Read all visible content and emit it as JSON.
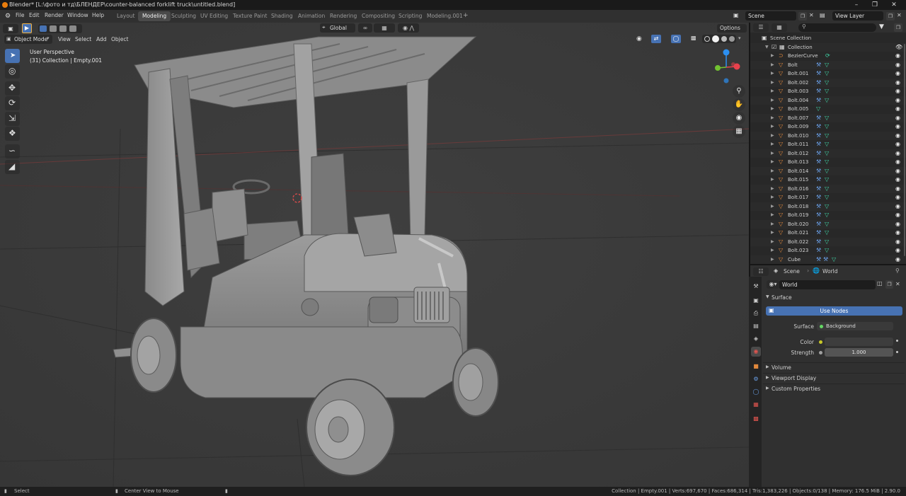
{
  "window": {
    "title": "Blender* [L:\\фото и тд\\БЛЕНДЕР\\counter-balanced forklift truck\\untitled.blend]"
  },
  "menus": [
    "File",
    "Edit",
    "Render",
    "Window",
    "Help"
  ],
  "workspaces": [
    {
      "label": "Layout",
      "active": false
    },
    {
      "label": "Modeling",
      "active": true
    },
    {
      "label": "Sculpting",
      "active": false
    },
    {
      "label": "UV Editing",
      "active": false
    },
    {
      "label": "Texture Paint",
      "active": false
    },
    {
      "label": "Shading",
      "active": false
    },
    {
      "label": "Animation",
      "active": false
    },
    {
      "label": "Rendering",
      "active": false
    },
    {
      "label": "Compositing",
      "active": false
    },
    {
      "label": "Scripting",
      "active": false
    },
    {
      "label": "Modeling.001",
      "active": false
    }
  ],
  "scene_selector": {
    "value": "Scene"
  },
  "view_layer_selector": {
    "value": "View Layer"
  },
  "viewport": {
    "mode": "Object Mode",
    "menus": [
      "View",
      "Select",
      "Add",
      "Object"
    ],
    "transform_orientation": "Global",
    "options_label": "Options",
    "overlay_line1": "User Perspective",
    "overlay_line2": "(31) Collection | Empty.001",
    "gizmo_axes": {
      "x": "X",
      "y": "Y",
      "z": "Z"
    }
  },
  "outliner": {
    "search_placeholder": "",
    "root": "Scene Collection",
    "collection": "Collection",
    "items": [
      {
        "name": "BezierCurve",
        "type": "curve",
        "mods": 0
      },
      {
        "name": "Bolt",
        "type": "mesh",
        "mods": 1
      },
      {
        "name": "Bolt.001",
        "type": "mesh",
        "mods": 1
      },
      {
        "name": "Bolt.002",
        "type": "mesh",
        "mods": 1
      },
      {
        "name": "Bolt.003",
        "type": "mesh",
        "mods": 1
      },
      {
        "name": "Bolt.004",
        "type": "mesh",
        "mods": 1
      },
      {
        "name": "Bolt.005",
        "type": "mesh",
        "mods": 0
      },
      {
        "name": "Bolt.007",
        "type": "mesh",
        "mods": 1
      },
      {
        "name": "Bolt.009",
        "type": "mesh",
        "mods": 1
      },
      {
        "name": "Bolt.010",
        "type": "mesh",
        "mods": 1
      },
      {
        "name": "Bolt.011",
        "type": "mesh",
        "mods": 1
      },
      {
        "name": "Bolt.012",
        "type": "mesh",
        "mods": 1
      },
      {
        "name": "Bolt.013",
        "type": "mesh",
        "mods": 1
      },
      {
        "name": "Bolt.014",
        "type": "mesh",
        "mods": 1
      },
      {
        "name": "Bolt.015",
        "type": "mesh",
        "mods": 1
      },
      {
        "name": "Bolt.016",
        "type": "mesh",
        "mods": 1
      },
      {
        "name": "Bolt.017",
        "type": "mesh",
        "mods": 1
      },
      {
        "name": "Bolt.018",
        "type": "mesh",
        "mods": 1
      },
      {
        "name": "Bolt.019",
        "type": "mesh",
        "mods": 1
      },
      {
        "name": "Bolt.020",
        "type": "mesh",
        "mods": 1
      },
      {
        "name": "Bolt.021",
        "type": "mesh",
        "mods": 1
      },
      {
        "name": "Bolt.022",
        "type": "mesh",
        "mods": 1
      },
      {
        "name": "Bolt.023",
        "type": "mesh",
        "mods": 1
      },
      {
        "name": "Cube",
        "type": "mesh",
        "mods": 2
      }
    ]
  },
  "properties": {
    "breadcrumb_scene": "Scene",
    "breadcrumb_world": "World",
    "world_name": "World",
    "surface_panel": "Surface",
    "use_nodes_label": "Use Nodes",
    "surface_label": "Surface",
    "surface_value": "Background",
    "color_label": "Color",
    "strength_label": "Strength",
    "strength_value": "1.000",
    "collapsed_panels": [
      "Volume",
      "Viewport Display",
      "Custom Properties"
    ]
  },
  "statusbar": {
    "left_select": "Select",
    "center": "Center View to Mouse",
    "stats": "Collection | Empty.001 | Verts:697,670 | Faces:686,314 | Tris:1,383,226 | Objects:0/138 | Memory: 176.5 MiB | 2.90.0"
  },
  "colors": {
    "accent": "#4772b3",
    "object_orange": "#e0883c",
    "mesh_green": "#3fd7a8",
    "modifier_blue": "#6aa0e8",
    "axis_x": "#e8414c",
    "axis_y": "#72c231",
    "axis_z": "#2c8ff0"
  }
}
